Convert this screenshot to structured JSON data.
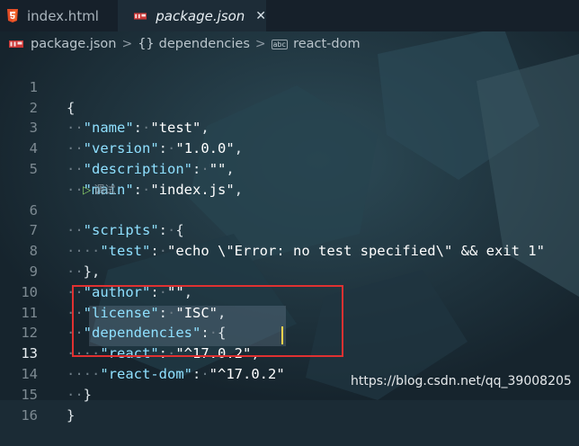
{
  "tabs": [
    {
      "label": "index.html",
      "icon": "html5-icon",
      "active": false
    },
    {
      "label": "package.json",
      "icon": "npm-icon",
      "active": true,
      "close": "✕"
    }
  ],
  "breadcrumb": {
    "file": "package.json",
    "separator": ">",
    "object": "dependencies",
    "object_icon": "{}",
    "property": "react-dom",
    "property_icon": "abc"
  },
  "codelens": "调试",
  "line_numbers": [
    "1",
    "2",
    "3",
    "4",
    "5",
    "6",
    "7",
    "8",
    "9",
    "10",
    "11",
    "12",
    "13",
    "14",
    "15",
    "16"
  ],
  "lines": {
    "l1": {
      "brace": "{"
    },
    "l2": {
      "key": "\"name\"",
      "colon": ":",
      "value": "\"test\"",
      "comma": ","
    },
    "l3": {
      "key": "\"version\"",
      "colon": ":",
      "value": "\"1.0.0\"",
      "comma": ","
    },
    "l4": {
      "key": "\"description\"",
      "colon": ":",
      "value": "\"\"",
      "comma": ","
    },
    "l5": {
      "key": "\"main\"",
      "colon": ":",
      "value": "\"index.js\"",
      "comma": ","
    },
    "l6": {
      "key": "\"scripts\"",
      "colon": ":",
      "brace": "{"
    },
    "l7": {
      "key": "\"test\"",
      "colon": ":",
      "value": "\"echo \\\"Error: no test specified\\\" && exit 1\""
    },
    "l8": {
      "brace": "},"
    },
    "l9": {
      "key": "\"author\"",
      "colon": ":",
      "value": "\"\"",
      "comma": ","
    },
    "l10": {
      "key": "\"license\"",
      "colon": ":",
      "value": "\"ISC\"",
      "comma": ","
    },
    "l11": {
      "key": "\"dependencies\"",
      "colon": ":",
      "brace": "{"
    },
    "l12": {
      "key": "\"react\"",
      "colon": ":",
      "value": "\"^17.0.2\"",
      "comma": ","
    },
    "l13": {
      "key": "\"react-dom\"",
      "colon": ":",
      "value": "\"^17.0.2\""
    },
    "l14": {
      "brace": "}"
    },
    "l15": {
      "brace": "}"
    }
  },
  "watermark": "https://blog.csdn.net/qq_39008205",
  "colors": {
    "key": "#8fe0ff",
    "string": "#ffffff",
    "cursor": "#ffd34d",
    "highlight_box": "#e03131",
    "background": "#1b2b35"
  }
}
